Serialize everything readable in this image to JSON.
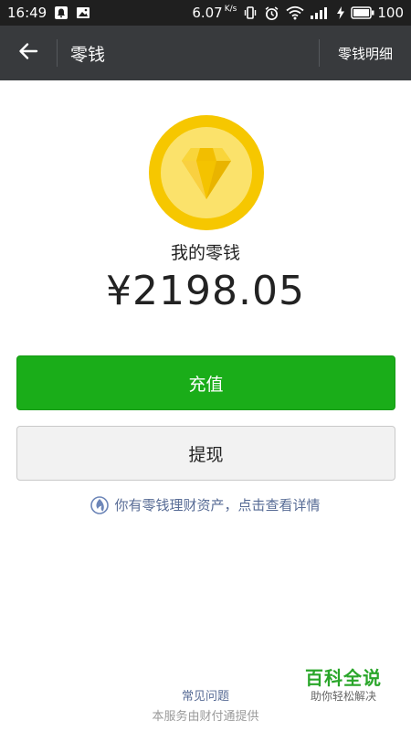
{
  "status_bar": {
    "time": "16:49",
    "speed_value": "6.07",
    "speed_unit": "K/s",
    "battery": "100",
    "icons": [
      "notification-bell-icon",
      "image-icon",
      "vibrate-icon",
      "alarm-icon",
      "wifi-icon",
      "signal-icon",
      "charging-icon",
      "battery-icon"
    ]
  },
  "nav": {
    "title": "零钱",
    "right_action": "零钱明细",
    "back_icon": "arrow-left-icon"
  },
  "balance": {
    "label": "我的零钱",
    "amount": "¥2198.05",
    "coin_color": "#f6c700",
    "icon": "diamond-icon"
  },
  "actions": {
    "recharge": "充值",
    "withdraw": "提现",
    "primary_color": "#1aad19"
  },
  "finance_link": {
    "text": "你有零钱理财资产，点击查看详情",
    "icon": "wealth-icon"
  },
  "footer": {
    "faq": "常见问题",
    "note": "本服务由财付通提供"
  },
  "watermark": {
    "title": "百科全说",
    "subtitle": "助你轻松解决"
  }
}
